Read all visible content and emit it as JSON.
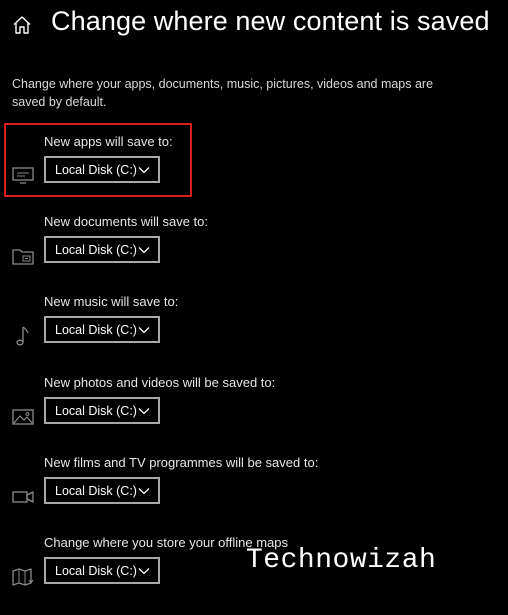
{
  "header": {
    "title": "Change where new content is saved",
    "home_icon": "home-icon"
  },
  "description": "Change where your apps, documents, music, pictures, videos and maps are saved by default.",
  "colors": {
    "background": "#000000",
    "text": "#ffffff",
    "highlight_border": "#d81e1e",
    "dropdown_border": "#a8a8a8"
  },
  "settings": [
    {
      "label": "New apps will save to:",
      "value": "Local Disk (C:)",
      "icon": "monitor-icon"
    },
    {
      "label": "New documents will save to:",
      "value": "Local Disk (C:)",
      "icon": "folder-icon"
    },
    {
      "label": "New music will save to:",
      "value": "Local Disk (C:)",
      "icon": "music-note-icon"
    },
    {
      "label": "New photos and videos will be saved to:",
      "value": "Local Disk (C:)",
      "icon": "photo-icon"
    },
    {
      "label": "New films and TV programmes will be saved to:",
      "value": "Local Disk (C:)",
      "icon": "video-camera-icon"
    },
    {
      "label": "Change where you store your offline maps",
      "value": "Local Disk (C:)",
      "icon": "map-icon"
    }
  ],
  "watermark": "Technowizah"
}
